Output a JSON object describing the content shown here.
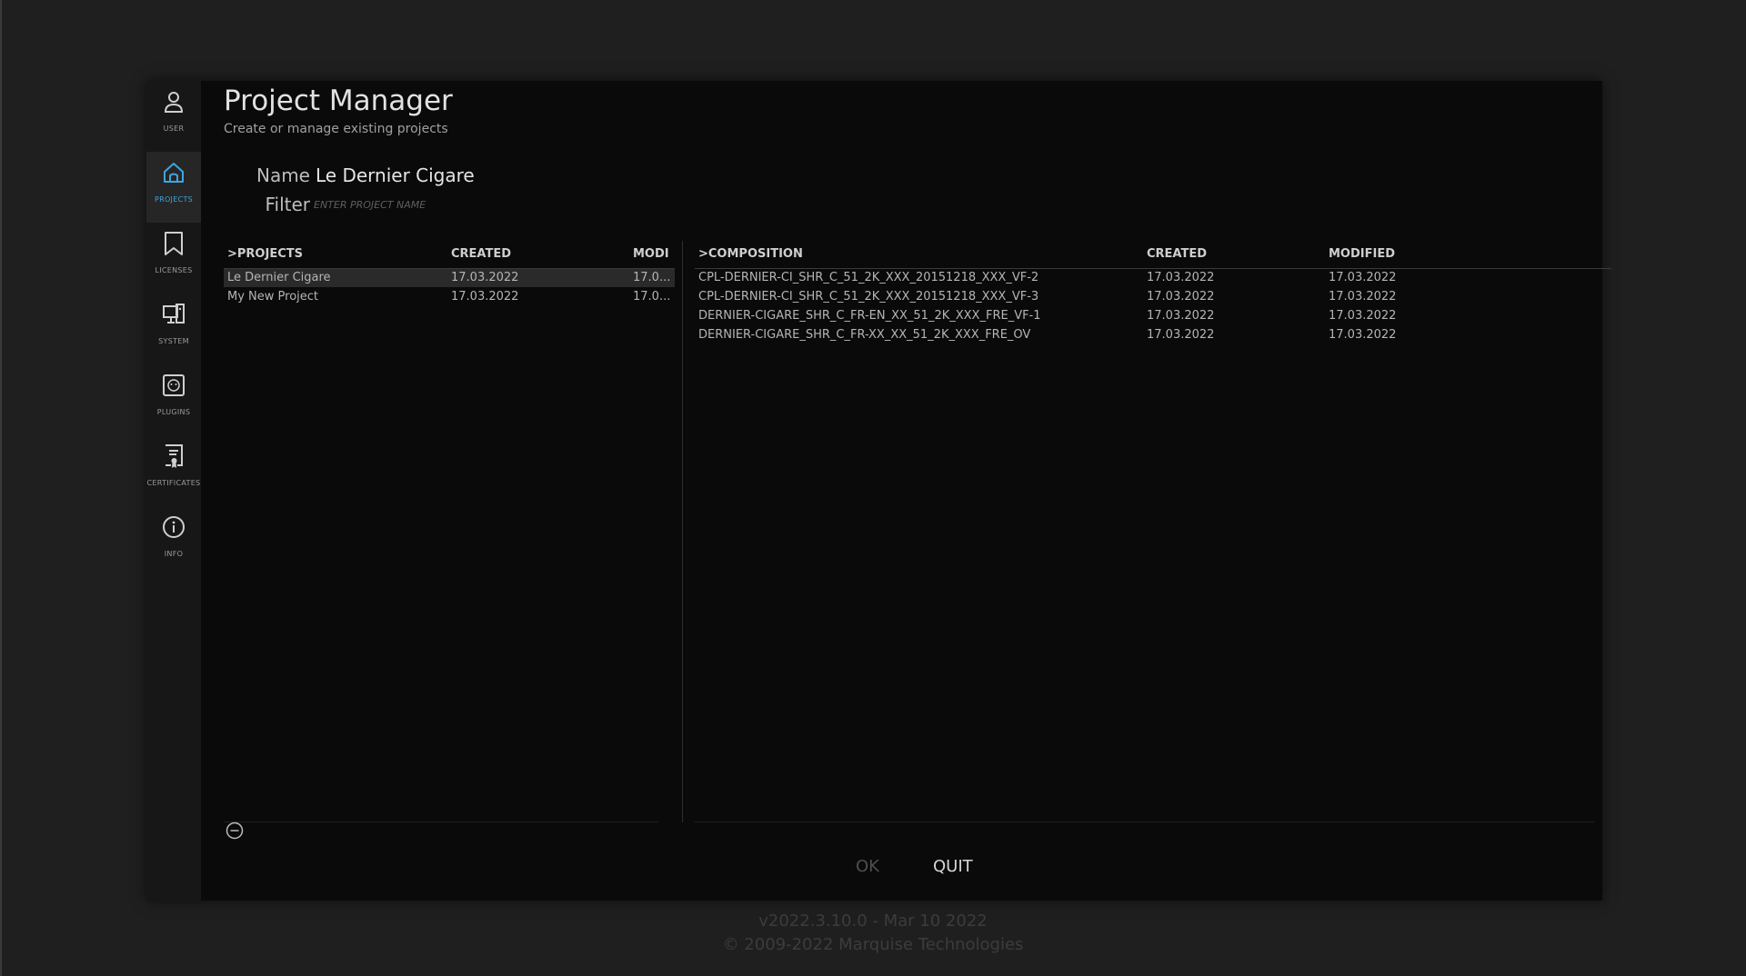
{
  "sidebar": {
    "items": [
      {
        "label": "USER",
        "icon": "user-icon"
      },
      {
        "label": "PROJECTS",
        "icon": "home-icon",
        "active": true
      },
      {
        "label": "LICENSES",
        "icon": "bookmark-icon"
      },
      {
        "label": "SYSTEM",
        "icon": "system-icon"
      },
      {
        "label": "PLUGINS",
        "icon": "plugin-icon"
      },
      {
        "label": "CERTIFICATES",
        "icon": "certificate-icon"
      },
      {
        "label": "INFO",
        "icon": "info-icon"
      }
    ]
  },
  "header": {
    "title": "Project Manager",
    "subtitle": "Create or manage existing projects"
  },
  "form": {
    "name_label": "Name",
    "name_value": "Le Dernier Cigare",
    "filter_label": "Filter",
    "filter_placeholder": "ENTER PROJECT NAME"
  },
  "projects_table": {
    "columns": [
      ">PROJECTS",
      "CREATED",
      "MODI"
    ],
    "rows": [
      {
        "name": "Le Dernier Cigare",
        "created": "17.03.2022",
        "modified": "17.0...",
        "selected": true
      },
      {
        "name": "My New Project",
        "created": "17.03.2022",
        "modified": "17.0..."
      }
    ]
  },
  "composition_table": {
    "columns": [
      ">COMPOSITION",
      "CREATED",
      "MODIFIED"
    ],
    "rows": [
      {
        "name": "CPL-DERNIER-CI_SHR_C_51_2K_XXX_20151218_XXX_VF-2",
        "created": "17.03.2022",
        "modified": "17.03.2022"
      },
      {
        "name": "CPL-DERNIER-CI_SHR_C_51_2K_XXX_20151218_XXX_VF-3",
        "created": "17.03.2022",
        "modified": "17.03.2022"
      },
      {
        "name": "DERNIER-CIGARE_SHR_C_FR-EN_XX_51_2K_XXX_FRE_VF-1",
        "created": "17.03.2022",
        "modified": "17.03.2022"
      },
      {
        "name": "DERNIER-CIGARE_SHR_C_FR-XX_XX_51_2K_XXX_FRE_OV",
        "created": "17.03.2022",
        "modified": "17.03.2022"
      }
    ]
  },
  "buttons": {
    "ok": "OK",
    "quit": "QUIT"
  },
  "footer": {
    "version": "v2022.3.10.0 - Mar 10 2022",
    "copyright": "© 2009-2022 Marquise Technologies"
  },
  "colors": {
    "accent": "#3ea6e0",
    "background": "#0a0a0a"
  }
}
